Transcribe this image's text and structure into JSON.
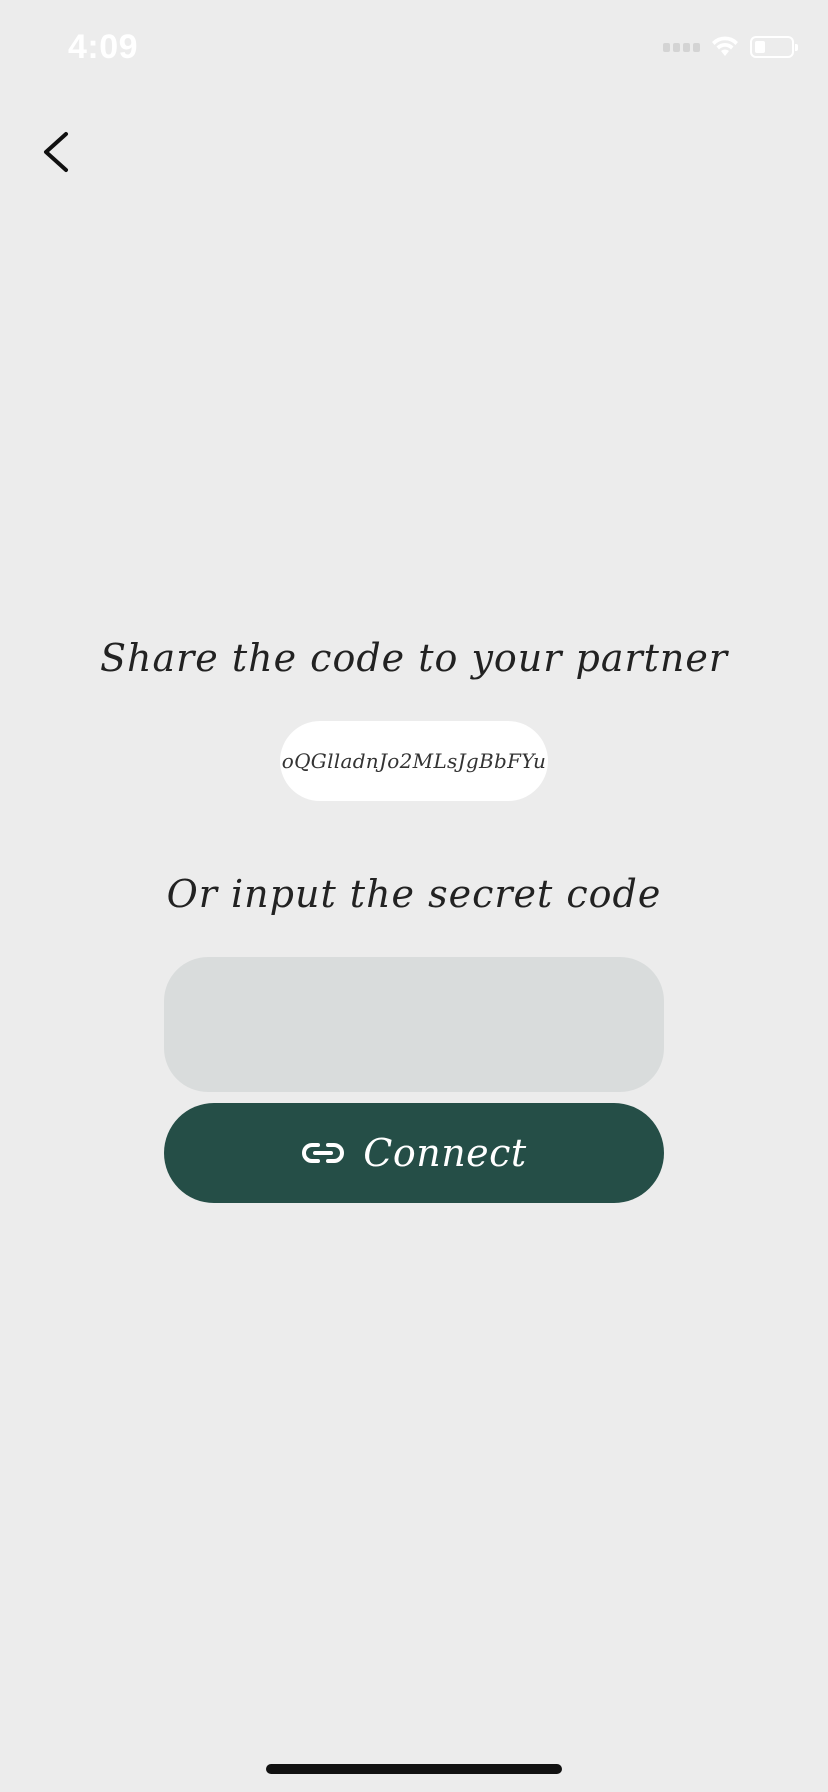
{
  "status_bar": {
    "time": "4:09",
    "icons": [
      "signal-icon",
      "wifi-icon",
      "battery-icon"
    ]
  },
  "nav": {
    "back_icon": "chevron-left-icon"
  },
  "share": {
    "title": "Share the code to your partner",
    "code": "oQGlladnJo2MLsJgBbFYu"
  },
  "input": {
    "title": "Or input the secret code",
    "value": "",
    "placeholder": ""
  },
  "connect": {
    "label": "Connect",
    "icon": "link-icon",
    "color": "#254e47"
  },
  "colors": {
    "background": "#ececec",
    "input_background": "#d9dcdc"
  }
}
